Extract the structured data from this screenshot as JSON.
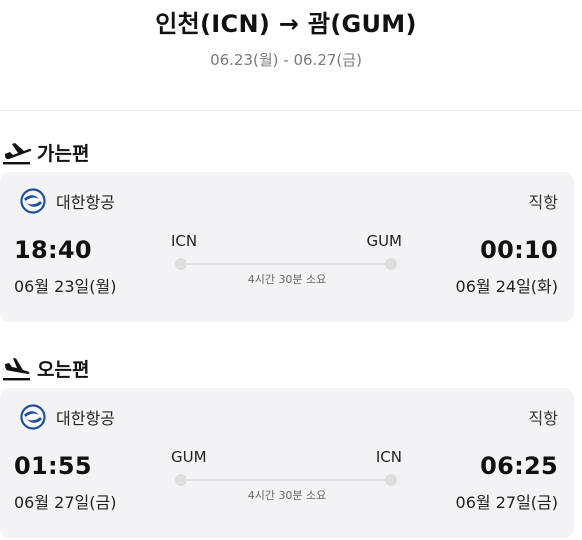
{
  "header": {
    "route": "인천(ICN) → 괌(GUM)",
    "dates": "06.23(월) - 06.27(금)"
  },
  "outbound": {
    "title": "가는편",
    "icon": "airplane-takeoff-icon",
    "airline": "대한항공",
    "airline_logo": "korean-air-logo",
    "direct": "직항",
    "dep_code": "ICN",
    "arr_code": "GUM",
    "dep_time": "18:40",
    "arr_time": "00:10",
    "dep_date": "06월 23일(월)",
    "arr_date": "06월 24일(화)",
    "duration": "4시간 30분 소요"
  },
  "inbound": {
    "title": "오는편",
    "icon": "airplane-landing-icon",
    "airline": "대한항공",
    "airline_logo": "korean-air-logo",
    "direct": "직항",
    "dep_code": "GUM",
    "arr_code": "ICN",
    "dep_time": "01:55",
    "arr_time": "06:25",
    "dep_date": "06월 27일(금)",
    "arr_date": "06월 27일(금)",
    "duration": "4시간 30분 소요"
  },
  "colors": {
    "card_bg": "#f3f3f5",
    "logo_blue": "#1f4fa0",
    "route_line": "#dedede"
  }
}
